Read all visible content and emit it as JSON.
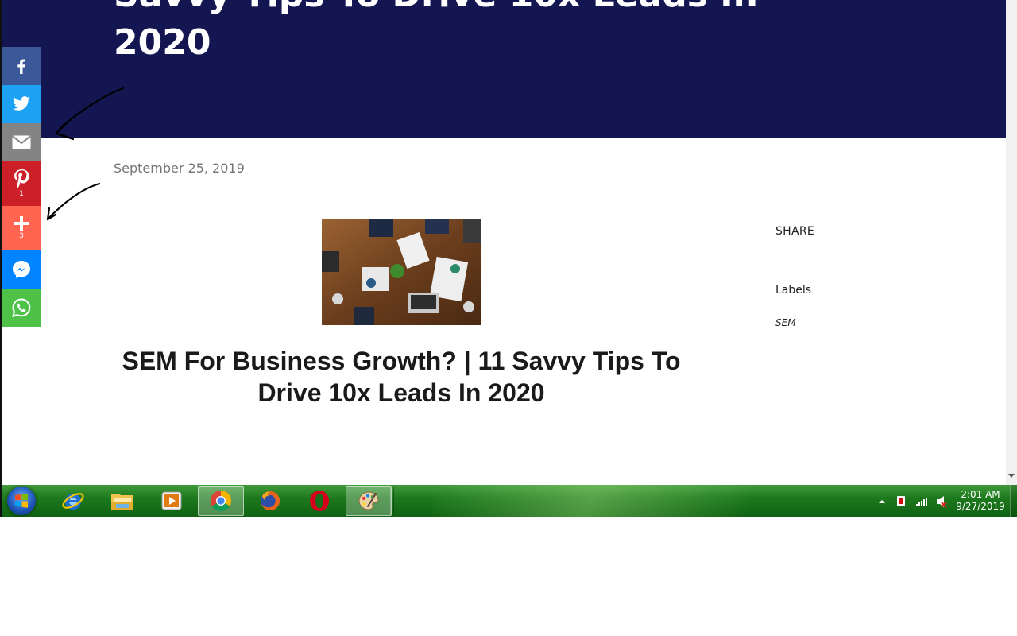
{
  "hero": {
    "title": "2020"
  },
  "post": {
    "date": "September 25, 2019",
    "heading": "SEM For Business Growth? | 11 Savvy Tips To Drive 10x Leads In 2020"
  },
  "sidebar": {
    "share_label": "SHARE",
    "labels_heading": "Labels",
    "labels": [
      "SEM"
    ]
  },
  "social": {
    "buttons": [
      {
        "name": "facebook",
        "icon": "facebook-icon",
        "color": "#3b5998"
      },
      {
        "name": "twitter",
        "icon": "twitter-icon",
        "color": "#1da1f2"
      },
      {
        "name": "email",
        "icon": "email-icon",
        "color": "#848484"
      },
      {
        "name": "pinterest",
        "icon": "pinterest-icon",
        "color": "#cb2027",
        "count": "1"
      },
      {
        "name": "more",
        "icon": "plus-icon",
        "color": "#ff6550",
        "count": "3"
      },
      {
        "name": "messenger",
        "icon": "messenger-icon",
        "color": "#0084ff"
      },
      {
        "name": "whatsapp",
        "icon": "whatsapp-icon",
        "color": "#4dc247"
      }
    ]
  },
  "colors": {
    "hero_bg": "#141652",
    "taskbar": "#1e7a1e"
  },
  "taskbar": {
    "apps": [
      "internet-explorer-icon",
      "file-explorer-icon",
      "media-player-icon",
      "chrome-icon",
      "firefox-icon",
      "opera-icon",
      "paint-icon"
    ],
    "active_app": "chrome-icon",
    "time": "2:01 AM",
    "date": "9/27/2019"
  }
}
